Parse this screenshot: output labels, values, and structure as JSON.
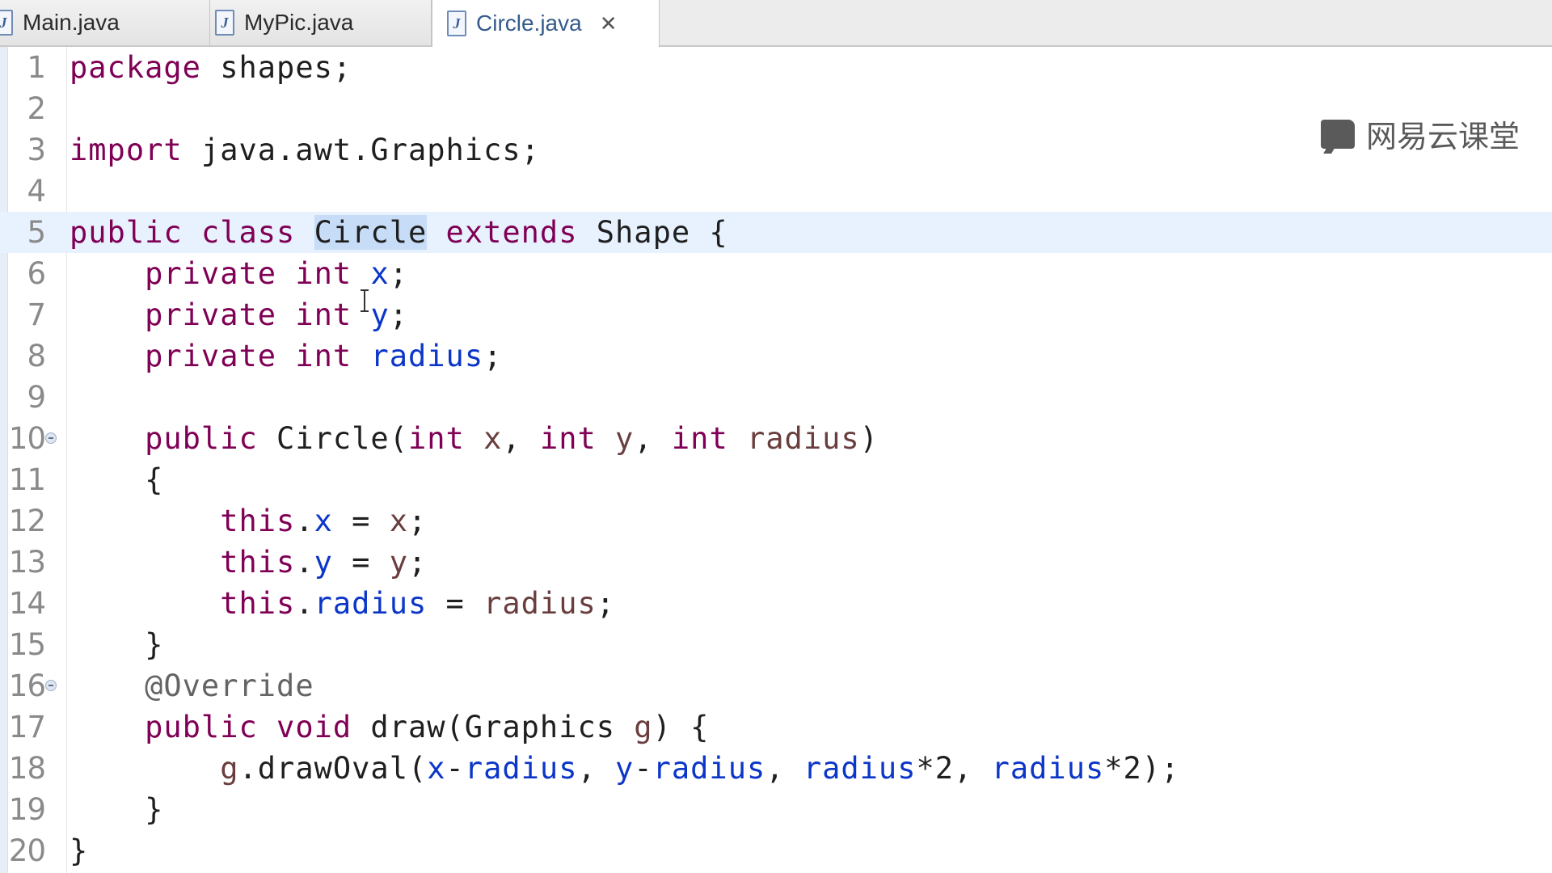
{
  "tabs": [
    {
      "label": "Main.java",
      "icon": "java-file-icon",
      "active": false
    },
    {
      "label": "MyPic.java",
      "icon": "java-file-icon",
      "active": false
    },
    {
      "label": "Circle.java",
      "icon": "java-file-icon",
      "active": true,
      "close_glyph": "✕"
    }
  ],
  "java_icon_glyph": "J",
  "watermark": {
    "text": "网易云课堂",
    "icon": "netease-cloud-classroom-logo-icon"
  },
  "current_line": 5,
  "selected_word": "Circle",
  "colors": {
    "keyword": "#7f0055",
    "field": "#0b36c8",
    "parameter": "#6a3e3e",
    "annotation": "#646464",
    "current_line_bg": "#e8f2fe",
    "selection_bg": "#c7dcf7"
  },
  "code_lines": [
    {
      "num": "1",
      "tokens": [
        {
          "t": "package",
          "c": "kw"
        },
        {
          "t": " shapes;"
        }
      ]
    },
    {
      "num": "2",
      "tokens": []
    },
    {
      "num": "3",
      "tokens": [
        {
          "t": "import",
          "c": "kw"
        },
        {
          "t": " java.awt.Graphics;"
        }
      ]
    },
    {
      "num": "4",
      "tokens": []
    },
    {
      "num": "5",
      "tokens": [
        {
          "t": "public",
          "c": "kw"
        },
        {
          "t": " "
        },
        {
          "t": "class",
          "c": "kw"
        },
        {
          "t": " "
        },
        {
          "t": "Circle",
          "c": "sel"
        },
        {
          "t": " "
        },
        {
          "t": "extends",
          "c": "kw"
        },
        {
          "t": " Shape {"
        }
      ]
    },
    {
      "num": "6",
      "tokens": [
        {
          "t": "    "
        },
        {
          "t": "private",
          "c": "kw"
        },
        {
          "t": " "
        },
        {
          "t": "int",
          "c": "kw"
        },
        {
          "t": " "
        },
        {
          "t": "x",
          "c": "fld"
        },
        {
          "t": ";"
        }
      ]
    },
    {
      "num": "7",
      "tokens": [
        {
          "t": "    "
        },
        {
          "t": "private",
          "c": "kw"
        },
        {
          "t": " "
        },
        {
          "t": "int",
          "c": "kw"
        },
        {
          "t": " "
        },
        {
          "t": "y",
          "c": "fld"
        },
        {
          "t": ";"
        }
      ]
    },
    {
      "num": "8",
      "tokens": [
        {
          "t": "    "
        },
        {
          "t": "private",
          "c": "kw"
        },
        {
          "t": " "
        },
        {
          "t": "int",
          "c": "kw"
        },
        {
          "t": " "
        },
        {
          "t": "radius",
          "c": "fld"
        },
        {
          "t": ";"
        }
      ]
    },
    {
      "num": "9",
      "tokens": []
    },
    {
      "num": "10",
      "fold": true,
      "tokens": [
        {
          "t": "    "
        },
        {
          "t": "public",
          "c": "kw"
        },
        {
          "t": " Circle("
        },
        {
          "t": "int",
          "c": "kw"
        },
        {
          "t": " "
        },
        {
          "t": "x",
          "c": "param"
        },
        {
          "t": ", "
        },
        {
          "t": "int",
          "c": "kw"
        },
        {
          "t": " "
        },
        {
          "t": "y",
          "c": "param"
        },
        {
          "t": ", "
        },
        {
          "t": "int",
          "c": "kw"
        },
        {
          "t": " "
        },
        {
          "t": "radius",
          "c": "param"
        },
        {
          "t": ")"
        }
      ]
    },
    {
      "num": "11",
      "tokens": [
        {
          "t": "    {"
        }
      ]
    },
    {
      "num": "12",
      "tokens": [
        {
          "t": "        "
        },
        {
          "t": "this",
          "c": "kw"
        },
        {
          "t": "."
        },
        {
          "t": "x",
          "c": "fld"
        },
        {
          "t": " = "
        },
        {
          "t": "x",
          "c": "param"
        },
        {
          "t": ";"
        }
      ]
    },
    {
      "num": "13",
      "tokens": [
        {
          "t": "        "
        },
        {
          "t": "this",
          "c": "kw"
        },
        {
          "t": "."
        },
        {
          "t": "y",
          "c": "fld"
        },
        {
          "t": " = "
        },
        {
          "t": "y",
          "c": "param"
        },
        {
          "t": ";"
        }
      ]
    },
    {
      "num": "14",
      "tokens": [
        {
          "t": "        "
        },
        {
          "t": "this",
          "c": "kw"
        },
        {
          "t": "."
        },
        {
          "t": "radius",
          "c": "fld"
        },
        {
          "t": " = "
        },
        {
          "t": "radius",
          "c": "param"
        },
        {
          "t": ";"
        }
      ]
    },
    {
      "num": "15",
      "tokens": [
        {
          "t": "    }"
        }
      ]
    },
    {
      "num": "16",
      "fold": true,
      "tokens": [
        {
          "t": "    "
        },
        {
          "t": "@Override",
          "c": "ann"
        }
      ]
    },
    {
      "num": "17",
      "tokens": [
        {
          "t": "    "
        },
        {
          "t": "public",
          "c": "kw"
        },
        {
          "t": " "
        },
        {
          "t": "void",
          "c": "kw"
        },
        {
          "t": " draw(Graphics "
        },
        {
          "t": "g",
          "c": "param"
        },
        {
          "t": ") {"
        }
      ]
    },
    {
      "num": "18",
      "tokens": [
        {
          "t": "        "
        },
        {
          "t": "g",
          "c": "param"
        },
        {
          "t": ".drawOval("
        },
        {
          "t": "x",
          "c": "fld"
        },
        {
          "t": "-"
        },
        {
          "t": "radius",
          "c": "fld"
        },
        {
          "t": ", "
        },
        {
          "t": "y",
          "c": "fld"
        },
        {
          "t": "-"
        },
        {
          "t": "radius",
          "c": "fld"
        },
        {
          "t": ", "
        },
        {
          "t": "radius",
          "c": "fld"
        },
        {
          "t": "*2, "
        },
        {
          "t": "radius",
          "c": "fld"
        },
        {
          "t": "*2);"
        }
      ]
    },
    {
      "num": "19",
      "tokens": [
        {
          "t": "    }"
        }
      ]
    },
    {
      "num": "20",
      "tokens": [
        {
          "t": "}"
        }
      ]
    }
  ]
}
